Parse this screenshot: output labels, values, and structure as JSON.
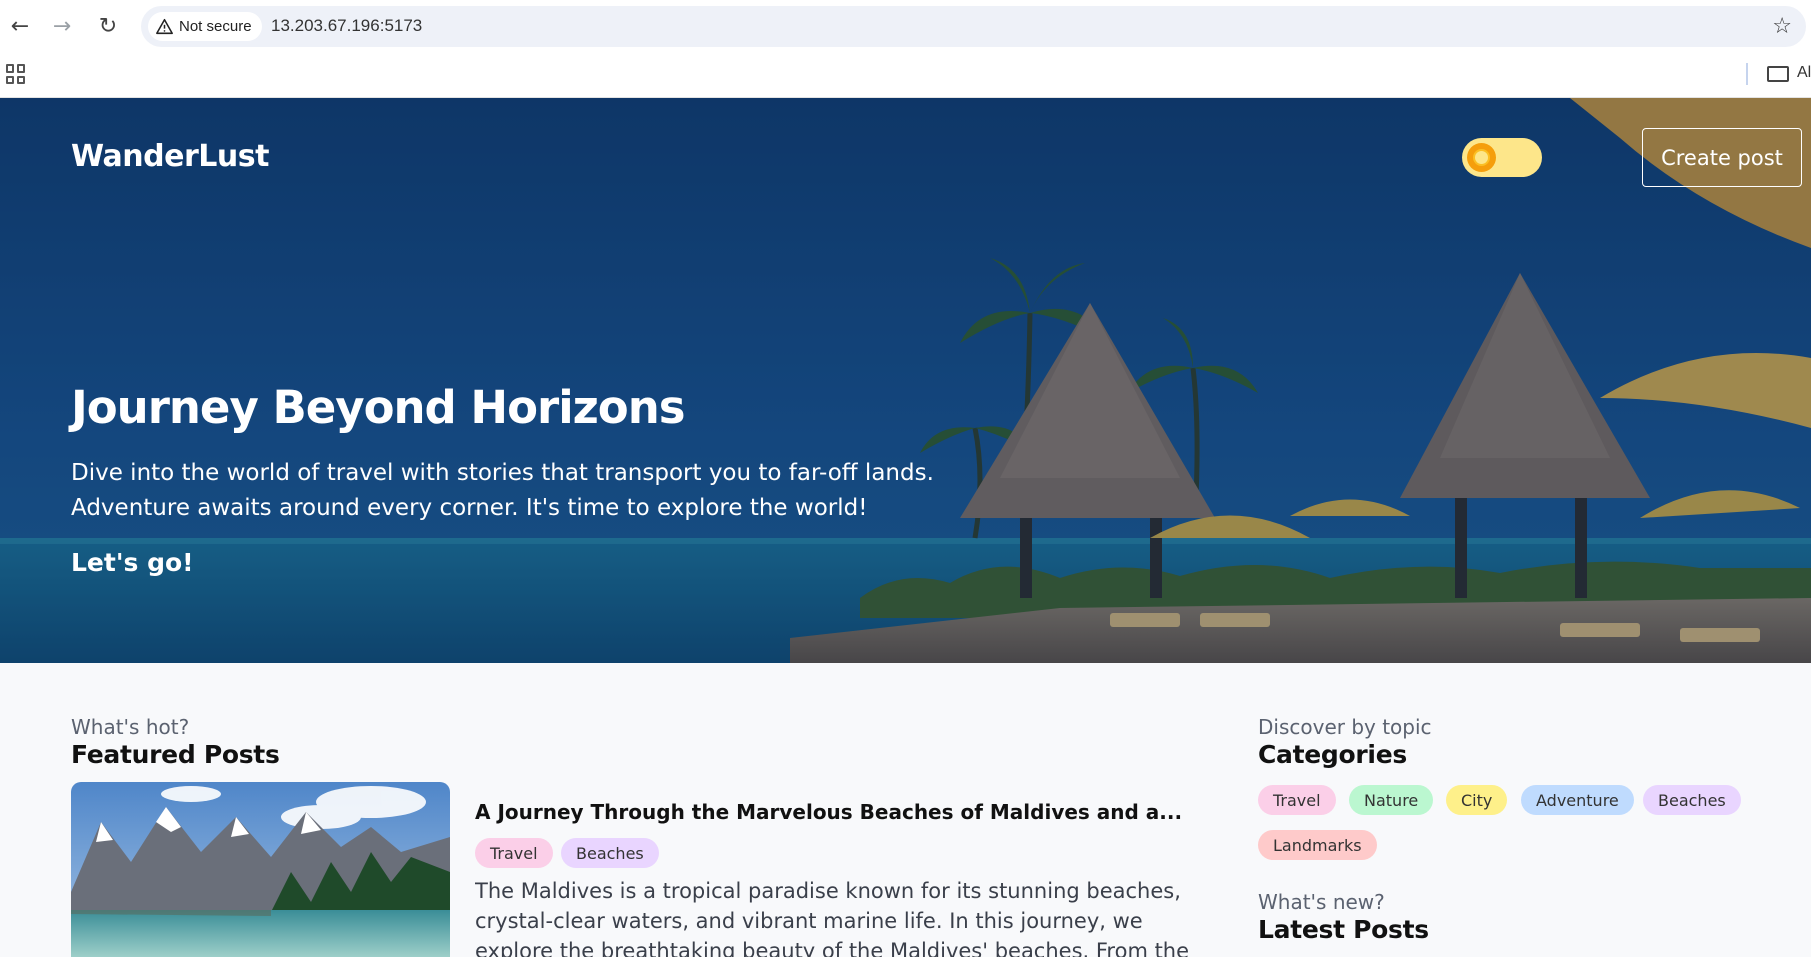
{
  "browser": {
    "security_label": "Not secure",
    "url": "13.203.67.196:5173",
    "bookmarks_all_label": "Al"
  },
  "header": {
    "brand": "WanderLust",
    "create_button": "Create post"
  },
  "hero": {
    "title": "Journey Beyond Horizons",
    "description": "Dive into the world of travel with stories that transport you to far-off lands. Adventure awaits around every corner. It's time to explore the world!",
    "cta": "Let's go!"
  },
  "featured": {
    "subtitle": "What's hot?",
    "title": "Featured Posts",
    "post": {
      "title": "A Journey Through the Marvelous Beaches of Maldives and a...",
      "tags": [
        "Travel",
        "Beaches"
      ],
      "excerpt": "The Maldives is a tropical paradise known for its stunning beaches, crystal-clear waters, and vibrant marine life. In this journey, we explore the breathtaking beauty of the Maldives' beaches. From the white sand"
    }
  },
  "categories": {
    "subtitle": "Discover by topic",
    "title": "Categories",
    "items": [
      "Travel",
      "Nature",
      "City",
      "Adventure",
      "Beaches",
      "Landmarks"
    ]
  },
  "latest": {
    "subtitle": "What's new?",
    "title": "Latest Posts"
  },
  "colors": {
    "tag_travel": "#fbcfe8",
    "tag_nature": "#bbf7d0",
    "tag_city": "#fef08a",
    "tag_adventure": "#bfdbfe",
    "tag_beaches": "#e9d5ff",
    "tag_landmarks": "#fecaca",
    "toggle_bg": "#fde68a",
    "hero_sky": "#134a84"
  }
}
